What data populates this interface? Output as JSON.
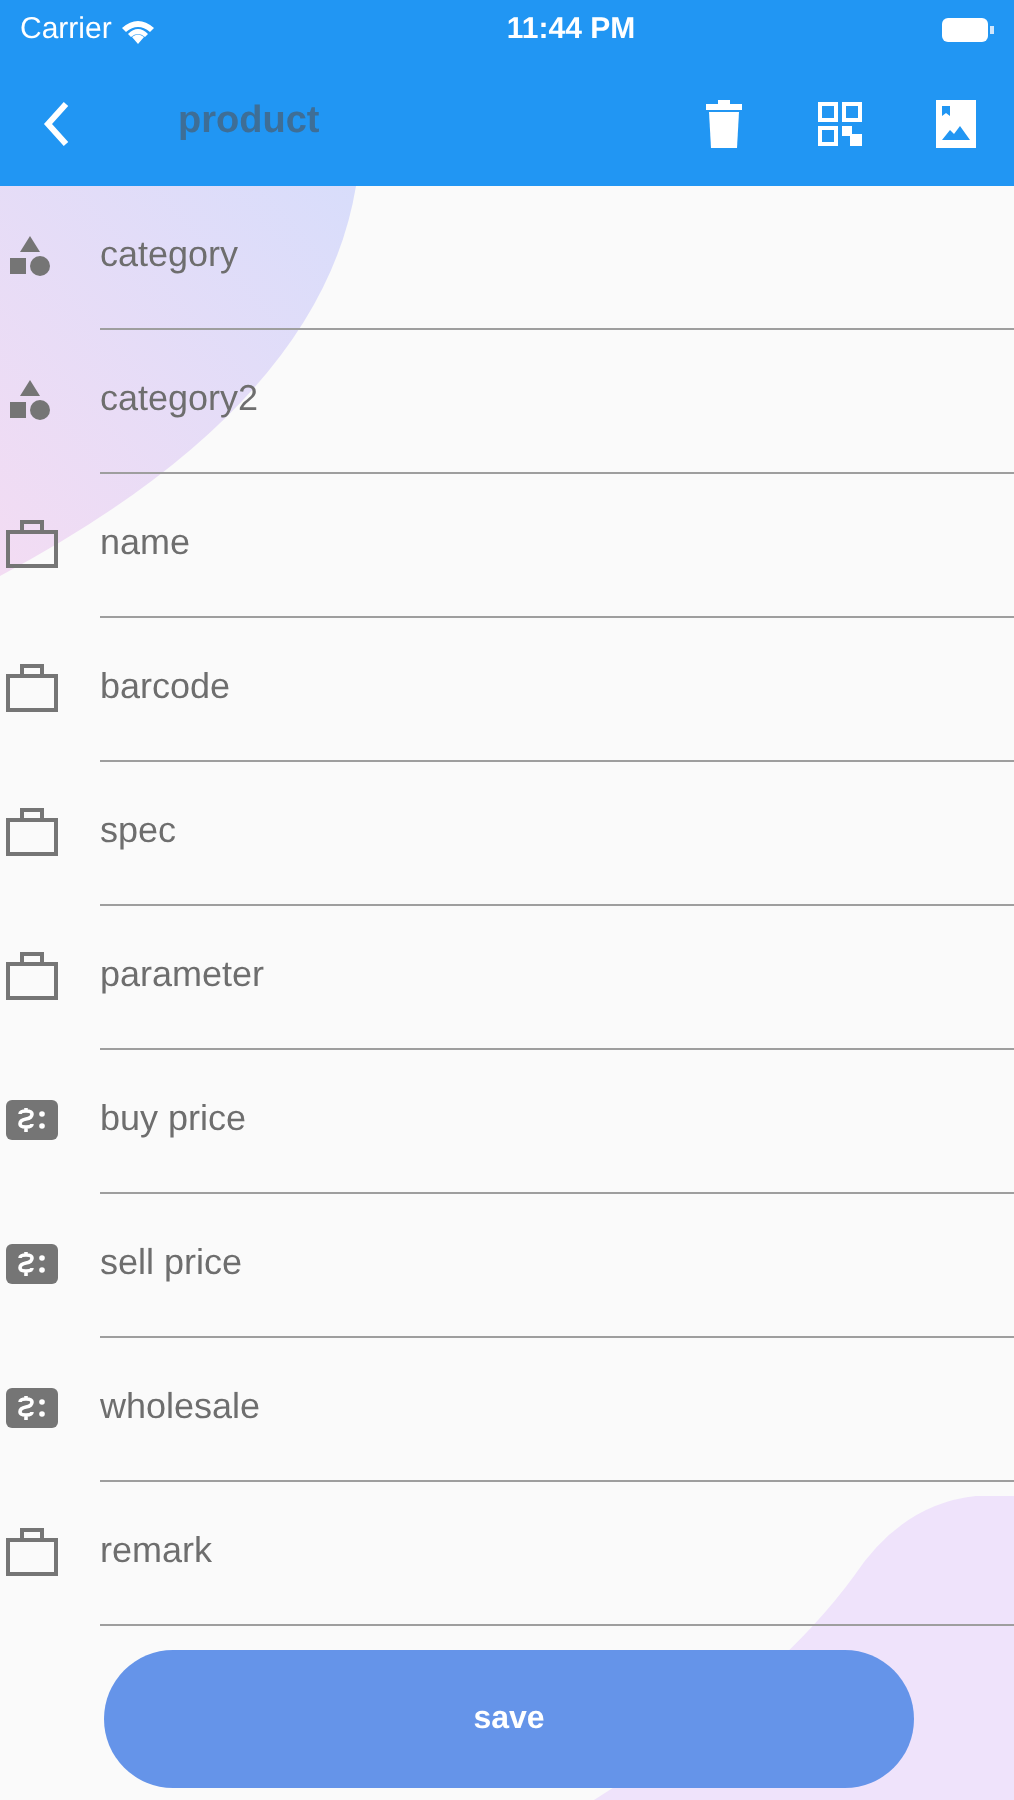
{
  "status_bar": {
    "carrier": "Carrier",
    "time": "11:44 PM"
  },
  "app_bar": {
    "title": "product"
  },
  "fields": [
    {
      "kind": "category",
      "placeholder": "category"
    },
    {
      "kind": "category",
      "placeholder": "category2"
    },
    {
      "kind": "text",
      "placeholder": "name"
    },
    {
      "kind": "text",
      "placeholder": "barcode"
    },
    {
      "kind": "text",
      "placeholder": "spec"
    },
    {
      "kind": "text",
      "placeholder": "parameter"
    },
    {
      "kind": "money",
      "placeholder": "buy price"
    },
    {
      "kind": "money",
      "placeholder": "sell price"
    },
    {
      "kind": "money",
      "placeholder": "wholesale"
    },
    {
      "kind": "text",
      "placeholder": "remark"
    }
  ],
  "save_button": {
    "label": "save"
  }
}
